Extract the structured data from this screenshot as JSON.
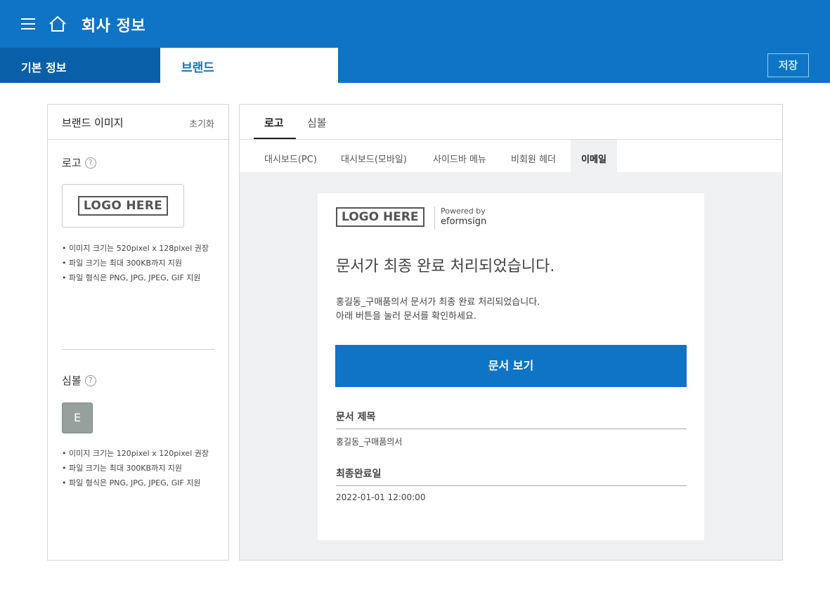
{
  "header": {
    "title": "회사 정보",
    "menu_icon": "hamburger-icon",
    "home_icon": "home-icon"
  },
  "tabs": {
    "basic": "기본 정보",
    "brand": "브랜드",
    "save": "저장"
  },
  "left": {
    "title": "브랜드 이미지",
    "reset": "초기화",
    "logo_label": "로고",
    "logo_text": "LOGO HERE",
    "logo_notes": [
      "• 이미지 크기는 520pixel x 128pixel 권장",
      "• 파일 크기는 최대 300KB까지 지원",
      "• 파일 형식은 PNG, JPG, JPEG, GIF 지원"
    ],
    "symbol_label": "심볼",
    "symbol_letter": "E",
    "symbol_notes": [
      "• 이미지 크기는 120pixel x 120pixel 권장",
      "• 파일 크기는 최대 300KB까지 지원",
      "• 파일 형식은 PNG, JPG, JPEG, GIF 지원"
    ],
    "help": "?"
  },
  "right": {
    "tabs": [
      "로고",
      "심볼"
    ],
    "sub_tabs": [
      "대시보드(PC)",
      "대시보드(모바일)",
      "사이드바 메뉴",
      "비회원 헤더",
      "이메일"
    ],
    "email": {
      "logo_text": "LOGO HERE",
      "powered_by": "Powered by",
      "powered_name": "eformsign",
      "heading": "문서가 최종 완료 처리되었습니다.",
      "body_line1": "홍길동_구매품의서 문서가 최종 완료 처리되었습니다.",
      "body_line2": "아래 버튼을 눌러 문서를 확인하세요.",
      "button": "문서 보기",
      "doc_title_label": "문서 제목",
      "doc_title_value": "홍길동_구매품의서",
      "completed_label": "최종완료일",
      "completed_value": "2022-01-01 12:00:00"
    }
  },
  "colors": {
    "primary": "#0f74c5",
    "tab_dark": "#0a60a8",
    "preview_bg": "#eef0f2"
  }
}
